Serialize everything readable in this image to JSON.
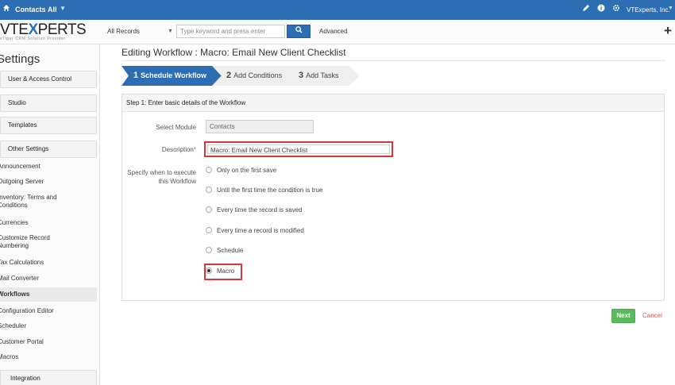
{
  "topbar": {
    "crumb_module": "Contacts",
    "crumb_filter": "All",
    "company": "VTExperts, Inc.",
    "icons": [
      "home-icon",
      "pencil-icon",
      "info-icon",
      "gear-icon"
    ]
  },
  "logo": {
    "brand_prefix": "VTE",
    "brand_x": "X",
    "brand_suffix": "PERTS",
    "tagline": "vTiger CRM Solution Provider"
  },
  "search": {
    "records_select": "All Records",
    "placeholder": "Type keyword and press enter",
    "advanced_label": "Advanced"
  },
  "sidebar": {
    "title": "Settings",
    "sections": {
      "user_access": "User & Access Control",
      "studio": "Studio",
      "templates": "Templates",
      "other_settings": "Other Settings",
      "integration": "Integration"
    },
    "items": [
      "Announcement",
      "Outgoing Server",
      "Inventory: Terms and Conditions",
      "Currencies",
      "Customize Record Numbering",
      "Tax Calculations",
      "Mail Converter",
      "Workflows",
      "Configuration Editor",
      "Scheduler",
      "Customer Portal",
      "Macros"
    ]
  },
  "main": {
    "title": "Editing Workflow : Macro: Email New Client Checklist",
    "steps": [
      {
        "num": "1",
        "label": "Schedule Workflow"
      },
      {
        "num": "2",
        "label": "Add Conditions"
      },
      {
        "num": "3",
        "label": "Add Tasks"
      }
    ],
    "panel_heading": "Step 1: Enter basic details of the Workflow",
    "select_module_label": "Select Module",
    "select_module_value": "Contacts",
    "description_label": "Description",
    "description_required": "*",
    "description_value": "Macro: Email New Client Checklist",
    "execute_label": "Specify when to execute this Workflow",
    "options": [
      "Only on the first save",
      "Until the first time the condition is true",
      "Every time the record is saved",
      "Every time a record is modified",
      "Schedule",
      "Macro"
    ],
    "selected_option": "Macro",
    "next_label": "Next",
    "cancel_label": "Cancel"
  }
}
